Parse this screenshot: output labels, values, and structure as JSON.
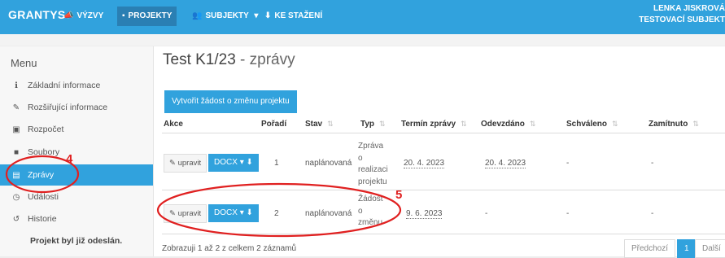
{
  "topnav": {
    "brand": "GRANTYS",
    "items": [
      {
        "icon": "megaphone-icon",
        "glyph": "📣",
        "label": "VÝZVY"
      },
      {
        "icon": "document-icon",
        "glyph": "▪",
        "label": "PROJEKTY"
      },
      {
        "icon": "group-icon",
        "glyph": "👥",
        "label": "SUBJEKTY",
        "caret": "▾"
      },
      {
        "icon": "download-icon",
        "glyph": "⬇",
        "label": "KE STAŽENÍ"
      }
    ],
    "user_name": "LENKA JISKROVÁ",
    "user_org": "TESTOVACÍ SUBJEKT"
  },
  "sidebar": {
    "title": "Menu",
    "items": [
      {
        "icon": "info-icon",
        "glyph": "ℹ",
        "label": "Základní informace"
      },
      {
        "icon": "edit-icon",
        "glyph": "✎",
        "label": "Rozšiřující informace"
      },
      {
        "icon": "budget-icon",
        "glyph": "▣",
        "label": "Rozpočet"
      },
      {
        "icon": "folder-icon",
        "glyph": "■",
        "label": "Soubory"
      },
      {
        "icon": "list-icon",
        "glyph": "▤",
        "label": "Zprávy"
      },
      {
        "icon": "clock-icon",
        "glyph": "◷",
        "label": "Události"
      },
      {
        "icon": "history-icon",
        "glyph": "↺",
        "label": "Historie"
      }
    ],
    "status": "Projekt byl již odeslán."
  },
  "main": {
    "title": "Test K1/23",
    "title_suffix": " - zprávy",
    "create_button": "Vytvořit žádost o změnu projektu",
    "columns": [
      "Akce",
      "Pořadí",
      "Stav",
      "Typ",
      "Termín zprávy",
      "Odevzdáno",
      "Schváleno",
      "Zamítnuto"
    ],
    "rows": [
      {
        "edit": "upravit",
        "docx": "DOCX",
        "order": "1",
        "state": "naplánovaná",
        "type_lines": [
          "Zpráva",
          "o",
          "realizaci",
          "projektu"
        ],
        "due": "20. 4. 2023",
        "submitted": "20. 4. 2023",
        "approved": "-",
        "rejected": "-"
      },
      {
        "edit": "upravit",
        "docx": "DOCX",
        "order": "2",
        "state": "naplánovaná",
        "type_lines": [
          "Žádost",
          "o",
          "změnu"
        ],
        "due": "9. 6. 2023",
        "submitted": "-",
        "approved": "-",
        "rejected": "-"
      }
    ],
    "footer": "Zobrazuji 1 až 2 z celkem 2 záznamů",
    "pager": {
      "prev": "Předchozí",
      "current": "1",
      "next": "Další"
    }
  },
  "annotations": {
    "label_4": "4",
    "label_5": "5",
    "color": "#e02020"
  }
}
